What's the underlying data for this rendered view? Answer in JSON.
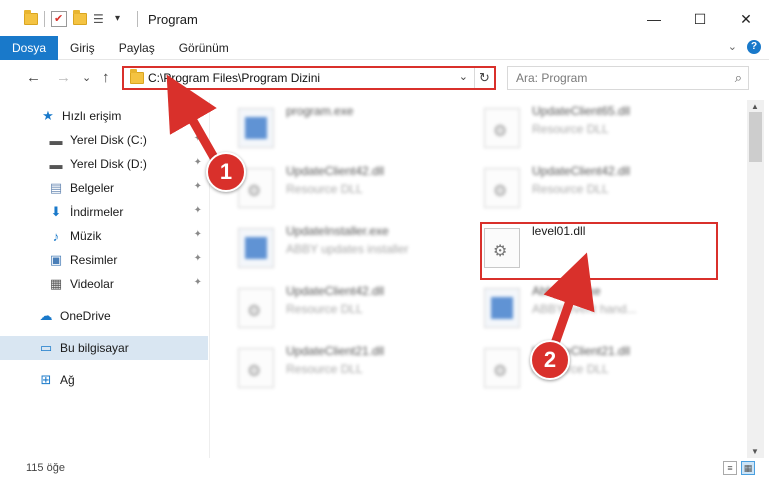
{
  "window": {
    "title": "Program",
    "minimize": "—",
    "maximize": "☐",
    "close": "✕"
  },
  "ribbon": {
    "tabs": [
      "Dosya",
      "Giriş",
      "Paylaş",
      "Görünüm"
    ],
    "help": "?"
  },
  "nav": {
    "back": "←",
    "forward": "→",
    "recent": "⌄",
    "up": "↑",
    "address": "C:\\Program Files\\Program Dizini",
    "address_chevron": "⌄",
    "refresh": "↻",
    "search_placeholder": "Ara: Program",
    "search_icon": "search-icon"
  },
  "sidebar": {
    "items": [
      {
        "label": "Hızlı erişim",
        "icon": "star-icon",
        "glyph": "★",
        "color": "#1979ca",
        "pinned": false
      },
      {
        "label": "Yerel Disk (C:)",
        "icon": "drive-icon",
        "glyph": "▬",
        "color": "#555",
        "pinned": true
      },
      {
        "label": "Yerel Disk (D:)",
        "icon": "drive-icon",
        "glyph": "▬",
        "color": "#555",
        "pinned": true
      },
      {
        "label": "Belgeler",
        "icon": "documents-icon",
        "glyph": "▤",
        "color": "#6b8bb5",
        "pinned": true
      },
      {
        "label": "İndirmeler",
        "icon": "download-icon",
        "glyph": "⬇",
        "color": "#1979ca",
        "pinned": true
      },
      {
        "label": "Müzik",
        "icon": "music-icon",
        "glyph": "♪",
        "color": "#1979ca",
        "pinned": true
      },
      {
        "label": "Resimler",
        "icon": "pictures-icon",
        "glyph": "▣",
        "color": "#4a7fb8",
        "pinned": true
      },
      {
        "label": "Videolar",
        "icon": "videos-icon",
        "glyph": "▦",
        "color": "#555",
        "pinned": true
      },
      {
        "label": "OneDrive",
        "icon": "cloud-icon",
        "glyph": "☁",
        "color": "#1979ca",
        "pinned": false
      },
      {
        "label": "Bu bilgisayar",
        "icon": "computer-icon",
        "glyph": "▭",
        "color": "#1979ca",
        "pinned": false
      },
      {
        "label": "Ağ",
        "icon": "network-icon",
        "glyph": "⊞",
        "color": "#1979ca",
        "pinned": false
      }
    ],
    "pin_glyph": "📌"
  },
  "files": [
    {
      "name": "program.exe",
      "desc": "",
      "type": "exe"
    },
    {
      "name": "UpdateClient65.dll",
      "desc": "Resource DLL",
      "type": "dll"
    },
    {
      "name": "UpdateClient42.dll",
      "desc": "Resource DLL",
      "type": "dll"
    },
    {
      "name": "UpdateClient42.dll",
      "desc": "Resource DLL",
      "type": "dll"
    },
    {
      "name": "UpdateInstaller.exe",
      "desc": "ABBY updates installer",
      "type": "exe"
    },
    {
      "name": "level01.dll",
      "desc": "",
      "type": "dll"
    },
    {
      "name": "UpdateClient42.dll",
      "desc": "Resource DLL",
      "type": "dll"
    },
    {
      "name": "AbbyNI1.exe",
      "desc": "ABBY event hand...",
      "type": "exe"
    },
    {
      "name": "UpdateClient21.dll",
      "desc": "Resource DLL",
      "type": "dll"
    },
    {
      "name": "UpdateClient21.dll",
      "desc": "Resource DLL",
      "type": "dll"
    }
  ],
  "status": {
    "count": "115 öğe"
  },
  "annotations": {
    "step1": "1",
    "step2": "2",
    "color": "#d9302b"
  }
}
